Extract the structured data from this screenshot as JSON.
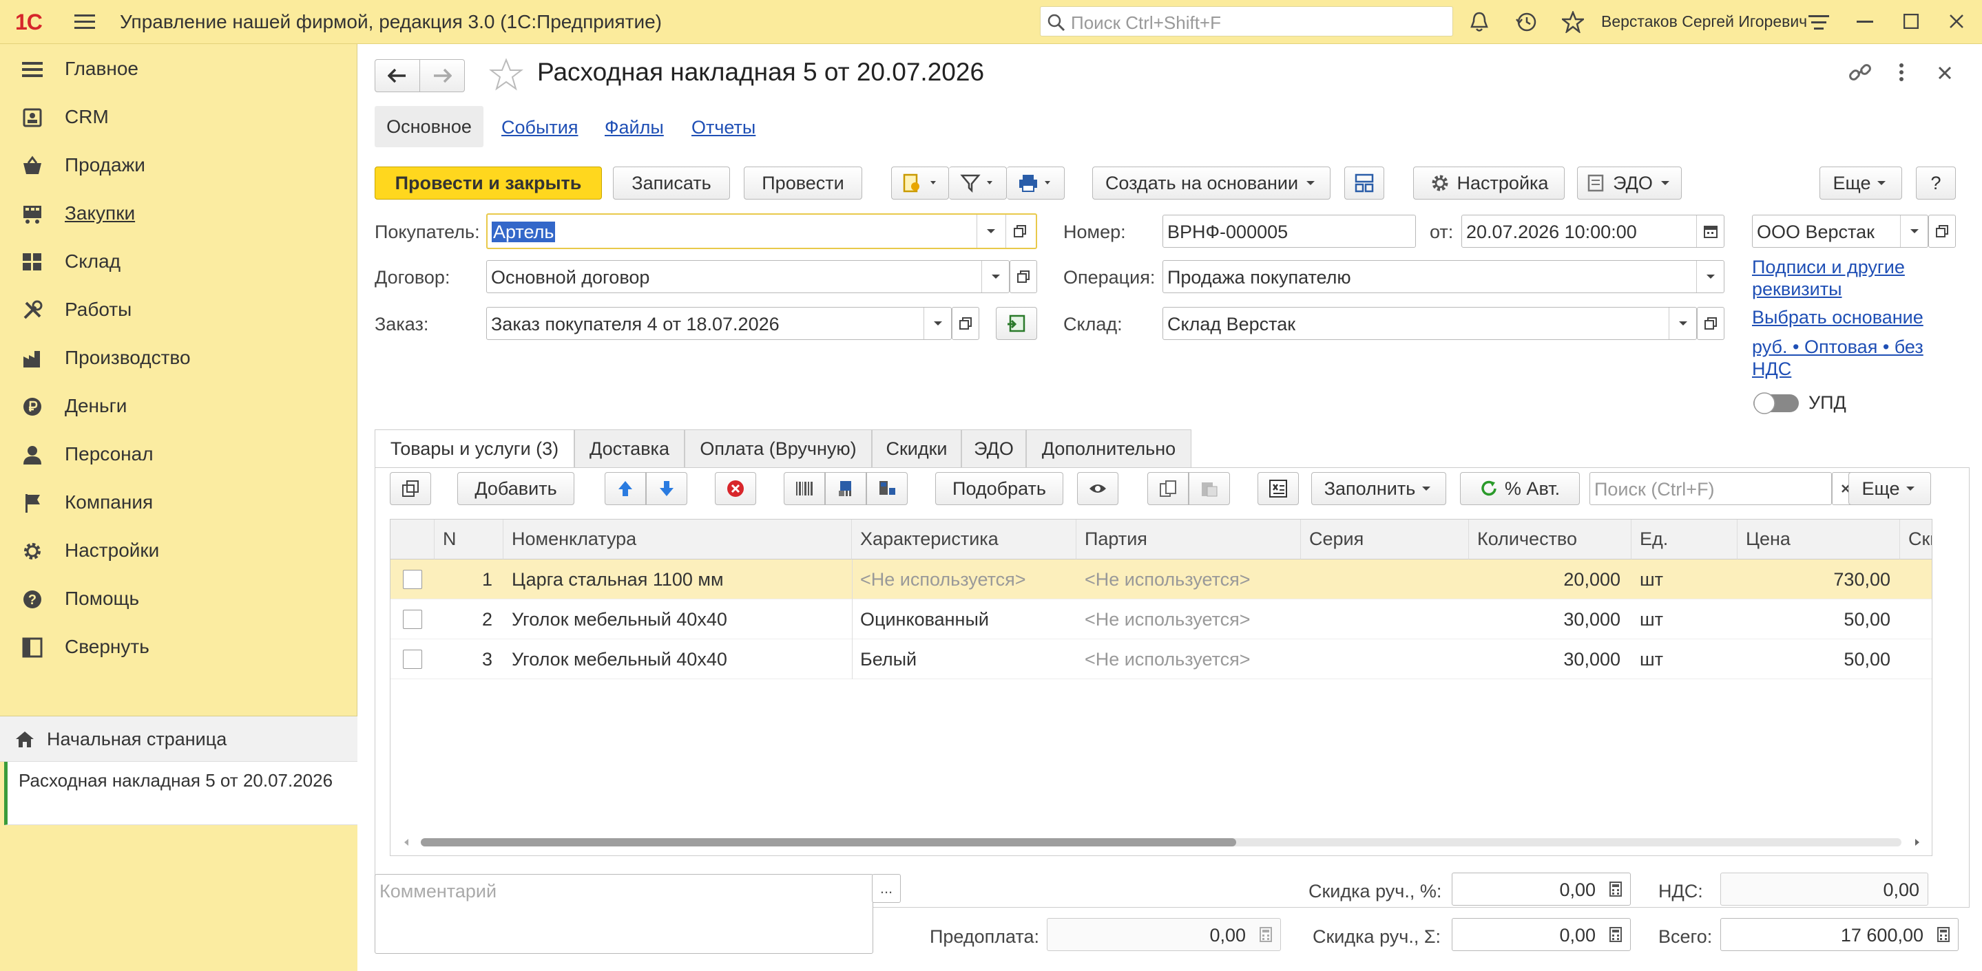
{
  "titlebar": {
    "logo": "1С",
    "app_title": "Управление нашей фирмой, редакция 3.0  (1С:Предприятие)",
    "search_placeholder": "Поиск Ctrl+Shift+F",
    "user_name": "Верстаков Сергей Игоревич"
  },
  "sidebar": {
    "items": [
      {
        "label": "Главное",
        "icon": "list-icon"
      },
      {
        "label": "CRM",
        "icon": "contacts-icon"
      },
      {
        "label": "Продажи",
        "icon": "basket-icon"
      },
      {
        "label": "Закупки",
        "icon": "cart-icon"
      },
      {
        "label": "Склад",
        "icon": "warehouse-icon"
      },
      {
        "label": "Работы",
        "icon": "tools-icon"
      },
      {
        "label": "Производство",
        "icon": "factory-icon"
      },
      {
        "label": "Деньги",
        "icon": "ruble-icon"
      },
      {
        "label": "Персонал",
        "icon": "person-icon"
      },
      {
        "label": "Компания",
        "icon": "flag-icon"
      },
      {
        "label": "Настройки",
        "icon": "gear-icon"
      },
      {
        "label": "Помощь",
        "icon": "help-icon"
      },
      {
        "label": "Свернуть",
        "icon": "collapse-icon"
      }
    ],
    "home_page": "Начальная страница",
    "open_document": "Расходная накладная 5 от 20.07.2026"
  },
  "document": {
    "title": "Расходная накладная 5 от 20.07.2026",
    "sections": {
      "main": "Основное",
      "events": "События",
      "files": "Файлы",
      "reports": "Отчеты"
    },
    "toolbar": {
      "post_close": "Провести и закрыть",
      "save": "Записать",
      "post": "Провести",
      "create_based": "Создать на основании",
      "settings": "Настройка",
      "edo": "ЭДО",
      "more": "Еще",
      "help": "?"
    },
    "fields": {
      "buyer_label": "Покупатель:",
      "buyer_value": "Артель",
      "contract_label": "Договор:",
      "contract_value": "Основной договор",
      "order_label": "Заказ:",
      "order_value": "Заказ покупателя 4 от 18.07.2026",
      "number_label": "Номер:",
      "number_value": "ВРНФ-000005",
      "date_label": "от:",
      "date_value": "20.07.2026 10:00:00",
      "operation_label": "Операция:",
      "operation_value": "Продажа покупателю",
      "warehouse_label": "Склад:",
      "warehouse_value": "Склад Верстак",
      "company_value": "ООО Верстак",
      "signatures_link": "Подписи и другие реквизиты",
      "choose_basis_link": "Выбрать основание",
      "price_type_link": "руб. • Оптовая • без НДС",
      "upd_label": "УПД"
    },
    "tabs": [
      "Товары и услуги (3)",
      "Доставка",
      "Оплата (Вручную)",
      "Скидки",
      "ЭДО",
      "Дополнительно"
    ],
    "table_toolbar": {
      "add": "Добавить",
      "pick": "Подобрать",
      "fill": "Заполнить",
      "auto_percent": "% Авт.",
      "search_placeholder": "Поиск (Ctrl+F)",
      "more": "Еще"
    },
    "table": {
      "columns": [
        "N",
        "Номенклатура",
        "Характеристика",
        "Партия",
        "Серия",
        "Количество",
        "Ед.",
        "Цена",
        "Ски"
      ],
      "rows": [
        {
          "n": "1",
          "item": "Царга стальная 1100 мм",
          "characteristic": "<Не используется>",
          "batch": "<Не используется>",
          "series": "",
          "qty": "20,000",
          "unit": "шт",
          "price": "730,00"
        },
        {
          "n": "2",
          "item": "Уголок мебельный 40х40",
          "characteristic": "Оцинкованный",
          "batch": "<Не используется>",
          "series": "",
          "qty": "30,000",
          "unit": "шт",
          "price": "50,00"
        },
        {
          "n": "3",
          "item": "Уголок мебельный 40х40",
          "characteristic": "Белый",
          "batch": "<Не используется>",
          "series": "",
          "qty": "30,000",
          "unit": "шт",
          "price": "50,00"
        }
      ]
    },
    "footer": {
      "comment_placeholder": "Комментарий",
      "comment_more": "...",
      "prepay_label": "Предоплата:",
      "prepay_value": "0,00",
      "discount_pct_label": "Скидка руч., %:",
      "discount_pct_value": "0,00",
      "discount_sum_label": "Скидка руч., Σ:",
      "discount_sum_value": "0,00",
      "vat_label": "НДС:",
      "vat_value": "0,00",
      "total_label": "Всего:",
      "total_value": "17 600,00"
    }
  },
  "colors": {
    "sidebar_bg": "#fbeca1",
    "primary_button": "#ffd71e",
    "link": "#1f4fb5",
    "selected_row": "#fcefbc",
    "logo_red": "#d6262b"
  }
}
